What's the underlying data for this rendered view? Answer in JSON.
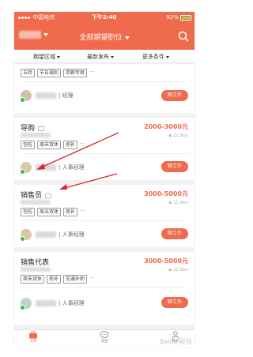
{
  "statusbar": {
    "carrier": "中国电信",
    "time": "下午2:40",
    "battery": "93%"
  },
  "header": {
    "city_caret": "",
    "title": "全部期望职位"
  },
  "filters": [
    {
      "label": "期望区域"
    },
    {
      "label": "最新发布"
    },
    {
      "label": "更多条件"
    }
  ],
  "top_partial": {
    "tags": [
      "五险",
      "节日福利",
      "带薪年假"
    ],
    "more": "···",
    "recruiter_role": "| 经理",
    "button": "聊工作"
  },
  "jobs": [
    {
      "title": "导购",
      "salary": "2000-3000元",
      "distance": "22.3km",
      "tags": [
        "包吃",
        "周末双休",
        "房补"
      ],
      "more": "···",
      "recruiter_role": "| 人事经理",
      "button": "聊工作"
    },
    {
      "title": "销售员",
      "salary": "3000-5000元",
      "distance": "22.3km",
      "tags": [
        "包吃",
        "周末双休",
        "房补"
      ],
      "more": "···",
      "recruiter_role": "| 人事经理",
      "button": "聊工作"
    },
    {
      "title": "销售代表",
      "salary": "3000-5000元",
      "distance": "12.3km",
      "tags": [
        "周末双休",
        "房补",
        "交通补助"
      ],
      "more": "···",
      "recruiter_role": "| 人事经理",
      "button": "聊工作"
    }
  ],
  "bottomnav": [
    {
      "label": "工作"
    },
    {
      "label": "消息"
    },
    {
      "label": "我的"
    }
  ],
  "watermark": "Baidu 经验",
  "colors": {
    "accent": "#f06a4e",
    "verified": "#3bbd4f",
    "annotation": "#d9262c"
  }
}
